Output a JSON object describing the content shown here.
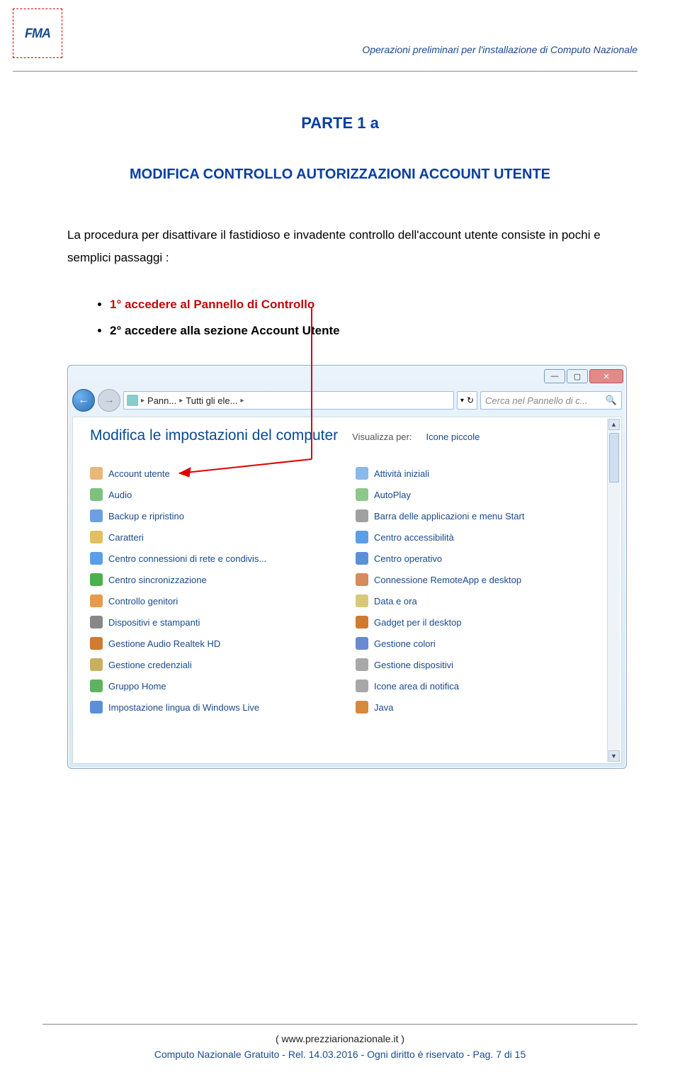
{
  "header": {
    "logo_text": "FMA",
    "doc_title": "Operazioni preliminari per l'installazione di Computo Nazionale"
  },
  "parte": "PARTE 1 a",
  "subtitle": "MODIFICA CONTROLLO AUTORIZZAZIONI ACCOUNT UTENTE",
  "paragraph": "La procedura per disattivare il fastidioso e invadente controllo dell'account utente consiste in pochi e semplici passaggi :",
  "steps": {
    "s1": "1° accedere al Pannello di Controllo",
    "s2": "2° accedere alla sezione Account Utente"
  },
  "win": {
    "titlebar": {
      "min": "—",
      "max": "▢",
      "close": "✕"
    },
    "nav": {
      "back": "←",
      "fwd": "→",
      "crumb1": "Pann...",
      "crumb2": "Tutti gli ele...",
      "search_placeholder": "Cerca nel Pannello di c...",
      "search_icon": "🔍"
    },
    "heading": "Modifica le impostazioni del computer",
    "view_label": "Visualizza per:",
    "view_value": "Icone piccole",
    "items_left": [
      "Account utente",
      "Audio",
      "Backup e ripristino",
      "Caratteri",
      "Centro connessioni di rete e condivis...",
      "Centro sincronizzazione",
      "Controllo genitori",
      "Dispositivi e stampanti",
      "Gestione Audio Realtek HD",
      "Gestione credenziali",
      "Gruppo Home",
      "Impostazione lingua di Windows Live"
    ],
    "items_right": [
      "Attività iniziali",
      "AutoPlay",
      "Barra delle applicazioni e menu Start",
      "Centro accessibilità",
      "Centro operativo",
      "Connessione RemoteApp e desktop",
      "Data e ora",
      "Gadget per il desktop",
      "Gestione colori",
      "Gestione dispositivi",
      "Icone area di notifica",
      "Java"
    ],
    "icon_colors_left": [
      "#e8b878",
      "#7cc27c",
      "#6aa0e0",
      "#e0c060",
      "#5a9de8",
      "#4cb04c",
      "#e89a4c",
      "#888",
      "#d07a30",
      "#c8b060",
      "#5eb35e",
      "#5a90d8"
    ],
    "icon_colors_right": [
      "#8ab8e8",
      "#8cc88c",
      "#a0a0a0",
      "#5a9de8",
      "#5a90d8",
      "#d88a5a",
      "#d8c878",
      "#d07a30",
      "#6a8ad0",
      "#a8a8a8",
      "#a8a8a8",
      "#d8883a"
    ]
  },
  "footer": {
    "line1": "( www.prezziarionazionale.it )",
    "line2": "Computo Nazionale Gratuito - Rel. 14.03.2016 -  Ogni diritto è riservato - Pag. 7 di 15"
  }
}
